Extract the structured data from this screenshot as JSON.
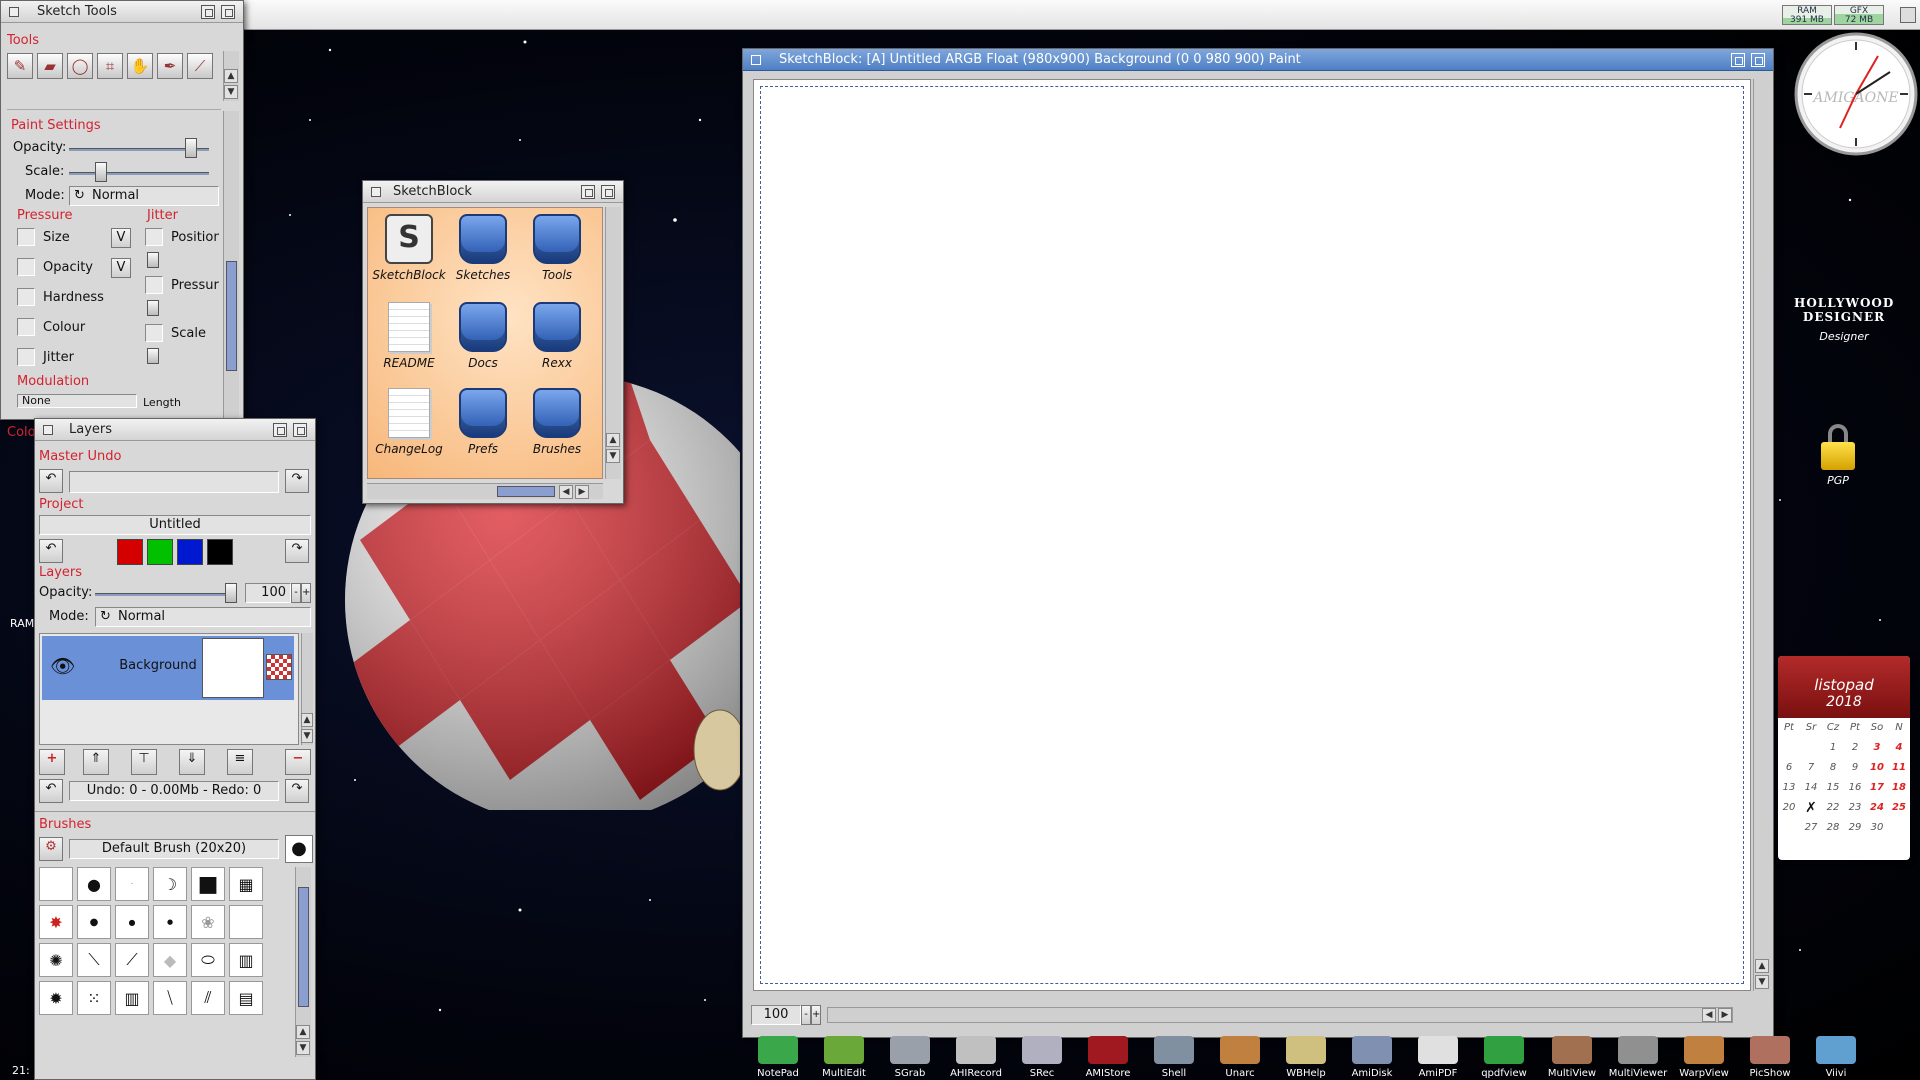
{
  "screen": {
    "meters": [
      {
        "label": "RAM",
        "value": "391 MB",
        "fill": 0.35
      },
      {
        "label": "GFX",
        "value": "72 MB",
        "fill": 0.55
      }
    ]
  },
  "sketch_tools": {
    "title": "Sketch Tools",
    "tools_label": "Tools",
    "tools": [
      "brush-tool-icon",
      "eraser-tool-icon",
      "lasso-tool-icon",
      "transform-tool-icon",
      "hand-tool-icon",
      "pen-tool-icon",
      "eyedropper-tool-icon"
    ],
    "paint_settings": {
      "label": "Paint Settings",
      "opacity_label": "Opacity:",
      "opacity_level": 0.95,
      "scale_label": "Scale:",
      "scale_level": 0.2,
      "mode_label": "Mode:",
      "mode_value": "Normal"
    },
    "pressure": {
      "label": "Pressure",
      "items": [
        "Size",
        "Opacity",
        "Hardness",
        "Colour",
        "Jitter"
      ],
      "v_buttons": [
        "V",
        "V"
      ]
    },
    "jitter": {
      "label": "Jitter",
      "items": [
        "Position",
        "Pressure",
        "Scale"
      ]
    },
    "modulation": {
      "label": "Modulation",
      "value": "None",
      "length_label": "Length"
    },
    "colour_label": "Colo"
  },
  "sketchblock_drawer": {
    "title": "SketchBlock",
    "icons": [
      {
        "label": "SketchBlock",
        "icon": "sketchblock-app-icon"
      },
      {
        "label": "Sketches",
        "icon": "drawer-icon"
      },
      {
        "label": "Tools",
        "icon": "drawer-icon"
      },
      {
        "label": "README",
        "icon": "document-icon"
      },
      {
        "label": "Docs",
        "icon": "drawer-icon"
      },
      {
        "label": "Rexx",
        "icon": "drawer-icon"
      },
      {
        "label": "ChangeLog",
        "icon": "document-icon"
      },
      {
        "label": "Prefs",
        "icon": "drawer-icon"
      },
      {
        "label": "Brushes",
        "icon": "drawer-icon"
      }
    ]
  },
  "layers_window": {
    "title": "Layers",
    "master_undo_label": "Master Undo",
    "master_undo_value": "",
    "project_label": "Project",
    "project_name": "Untitled",
    "project_colors": [
      "#d40000",
      "#00c000",
      "#0018d0",
      "#000000"
    ],
    "layers_label": "Layers",
    "opacity_label": "Opacity:",
    "opacity_value": "100",
    "mode_label": "Mode:",
    "mode_value": "Normal",
    "layer_rows": [
      {
        "name": "Background"
      }
    ],
    "undo_status": "Undo: 0 - 0.00Mb - Redo: 0",
    "brushes_label": "Brushes",
    "brush_name": "Default Brush (20x20)"
  },
  "canvas_window": {
    "title": "SketchBlock:  [A]  Untitled   ARGB Float (980x900) Background (0 0 980 900) Paint",
    "zoom": "100"
  },
  "desktop_icons": [
    {
      "label": "Designer",
      "icon": "hollywood-designer-icon",
      "logo_text": "HOLLYWOOD DESIGNER"
    },
    {
      "label": "PGP",
      "icon": "padlock-icon"
    }
  ],
  "clock": {
    "brand": "AMIGAONE"
  },
  "calendar": {
    "month": "listopad",
    "year": "2018",
    "weekdays": [
      "Pt",
      "Sr",
      "Cz",
      "Pt",
      "So",
      "N"
    ],
    "rows": [
      [
        "",
        "",
        "1",
        "2",
        "3",
        "4"
      ],
      [
        "6",
        "7",
        "8",
        "9",
        "10",
        "11"
      ],
      [
        "13",
        "14",
        "15",
        "16",
        "17",
        "18"
      ],
      [
        "20",
        "",
        "22",
        "23",
        "24",
        "25"
      ],
      [
        "",
        "27",
        "28",
        "29",
        "30",
        ""
      ]
    ]
  },
  "dock": {
    "items": [
      {
        "label": "NotePad",
        "color": "#3aa84a"
      },
      {
        "label": "MultiEdit",
        "color": "#6aa83a"
      },
      {
        "label": "SGrab",
        "color": "#9aa0aa"
      },
      {
        "label": "AHIRecord",
        "color": "#c0c0c0"
      },
      {
        "label": "SRec",
        "color": "#b0b0c0"
      },
      {
        "label": "AMIStore",
        "color": "#a01820"
      },
      {
        "label": "Shell",
        "color": "#8090a0"
      },
      {
        "label": "Unarc",
        "color": "#c08040"
      },
      {
        "label": "WBHelp",
        "color": "#d0c080"
      },
      {
        "label": "AmiDisk",
        "color": "#8090b0"
      },
      {
        "label": "AmiPDF",
        "color": "#e0e0e0"
      },
      {
        "label": "qpdfview",
        "color": "#30a040"
      },
      {
        "label": "MultiView",
        "color": "#a07050"
      },
      {
        "label": "MultiViewer",
        "color": "#909090"
      },
      {
        "label": "WarpView",
        "color": "#c08040"
      },
      {
        "label": "PicShow",
        "color": "#b07060"
      },
      {
        "label": "Viivi",
        "color": "#60a0d0"
      }
    ]
  },
  "edge_labels": {
    "left_ram": "RAM",
    "left_time": "21:"
  }
}
